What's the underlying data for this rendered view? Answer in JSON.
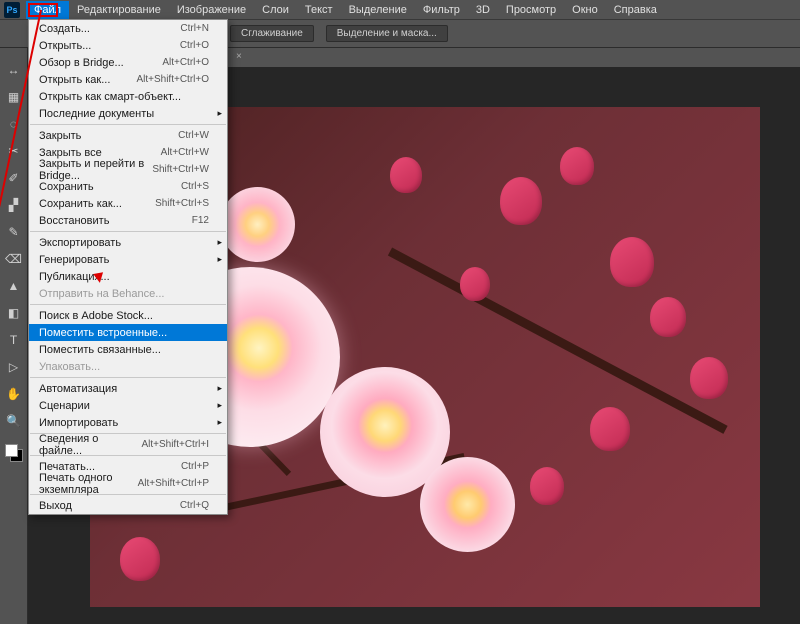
{
  "app_icon": "Ps",
  "menubar": [
    "Файл",
    "Редактирование",
    "Изображение",
    "Слои",
    "Текст",
    "Выделение",
    "Фильтр",
    "3D",
    "Просмотр",
    "Окно",
    "Справка"
  ],
  "optionbar": {
    "btn1": "Сглаживание",
    "btn2": "Выделение и маска..."
  },
  "tab": {
    "close": "×"
  },
  "tools": [
    "↔",
    "▦",
    "◌",
    "✂",
    "✐",
    "▞",
    "✎",
    "⌫",
    "▲",
    "◧",
    "T",
    "▷",
    "✋",
    "🔍"
  ],
  "dropdown": {
    "g1": [
      {
        "label": "Создать...",
        "short": "Ctrl+N"
      },
      {
        "label": "Открыть...",
        "short": "Ctrl+O"
      },
      {
        "label": "Обзор в Bridge...",
        "short": "Alt+Ctrl+O"
      },
      {
        "label": "Открыть как...",
        "short": "Alt+Shift+Ctrl+O"
      },
      {
        "label": "Открыть как смарт-объект...",
        "short": ""
      },
      {
        "label": "Последние документы",
        "short": "",
        "sub": true
      }
    ],
    "g2": [
      {
        "label": "Закрыть",
        "short": "Ctrl+W"
      },
      {
        "label": "Закрыть все",
        "short": "Alt+Ctrl+W"
      },
      {
        "label": "Закрыть и перейти в Bridge...",
        "short": "Shift+Ctrl+W"
      },
      {
        "label": "Сохранить",
        "short": "Ctrl+S"
      },
      {
        "label": "Сохранить как...",
        "short": "Shift+Ctrl+S"
      },
      {
        "label": "Восстановить",
        "short": "F12"
      }
    ],
    "g3": [
      {
        "label": "Экспортировать",
        "short": "",
        "sub": true
      },
      {
        "label": "Генерировать",
        "short": "",
        "sub": true
      },
      {
        "label": "Публикация...",
        "short": ""
      },
      {
        "label": "Отправить на Behance...",
        "short": "",
        "dis": true
      }
    ],
    "g4": [
      {
        "label": "Поиск в Adobe Stock...",
        "short": ""
      },
      {
        "label": "Поместить встроенные...",
        "short": "",
        "hl": true
      },
      {
        "label": "Поместить связанные...",
        "short": ""
      },
      {
        "label": "Упаковать...",
        "short": "",
        "dis": true
      }
    ],
    "g5": [
      {
        "label": "Автоматизация",
        "short": "",
        "sub": true
      },
      {
        "label": "Сценарии",
        "short": "",
        "sub": true
      },
      {
        "label": "Импортировать",
        "short": "",
        "sub": true
      }
    ],
    "g6": [
      {
        "label": "Сведения о файле...",
        "short": "Alt+Shift+Ctrl+I"
      }
    ],
    "g7": [
      {
        "label": "Печатать...",
        "short": "Ctrl+P"
      },
      {
        "label": "Печать одного экземпляра",
        "short": "Alt+Shift+Ctrl+P"
      }
    ],
    "g8": [
      {
        "label": "Выход",
        "short": "Ctrl+Q"
      }
    ]
  }
}
